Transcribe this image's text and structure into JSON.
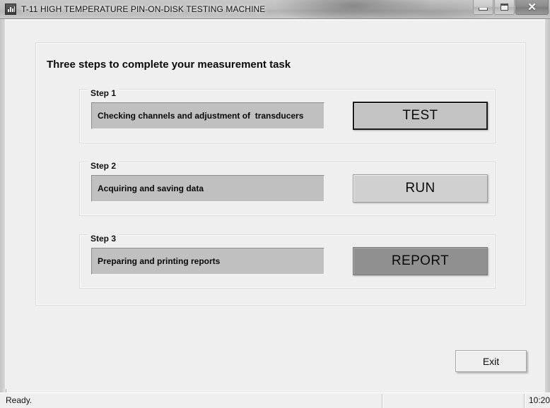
{
  "window": {
    "title": "T-11 HIGH TEMPERATURE PIN-ON-DISK TESTING MACHINE",
    "icon": "bar-chart-icon",
    "controls": {
      "minimize": "–",
      "maximize": "□",
      "close": "✕"
    }
  },
  "main": {
    "group_title": "Three steps to complete your measurement task",
    "steps": [
      {
        "label": "Step 1",
        "description": "Checking channels and adjustment of  transducers",
        "button": "TEST"
      },
      {
        "label": "Step 2",
        "description": "Acquiring and saving data",
        "button": "RUN"
      },
      {
        "label": "Step 3",
        "description": "Preparing and printing reports",
        "button": "REPORT"
      }
    ],
    "exit_label": "Exit"
  },
  "statusbar": {
    "message": "Ready.",
    "time": "10:20"
  },
  "colors": {
    "client_background": "#efefef",
    "description_panel": "#c0c0c0",
    "test_button": "#c3c3c3",
    "run_button": "#d0d0d0",
    "report_button": "#909090",
    "default_button_border": "#1a1a1a"
  }
}
